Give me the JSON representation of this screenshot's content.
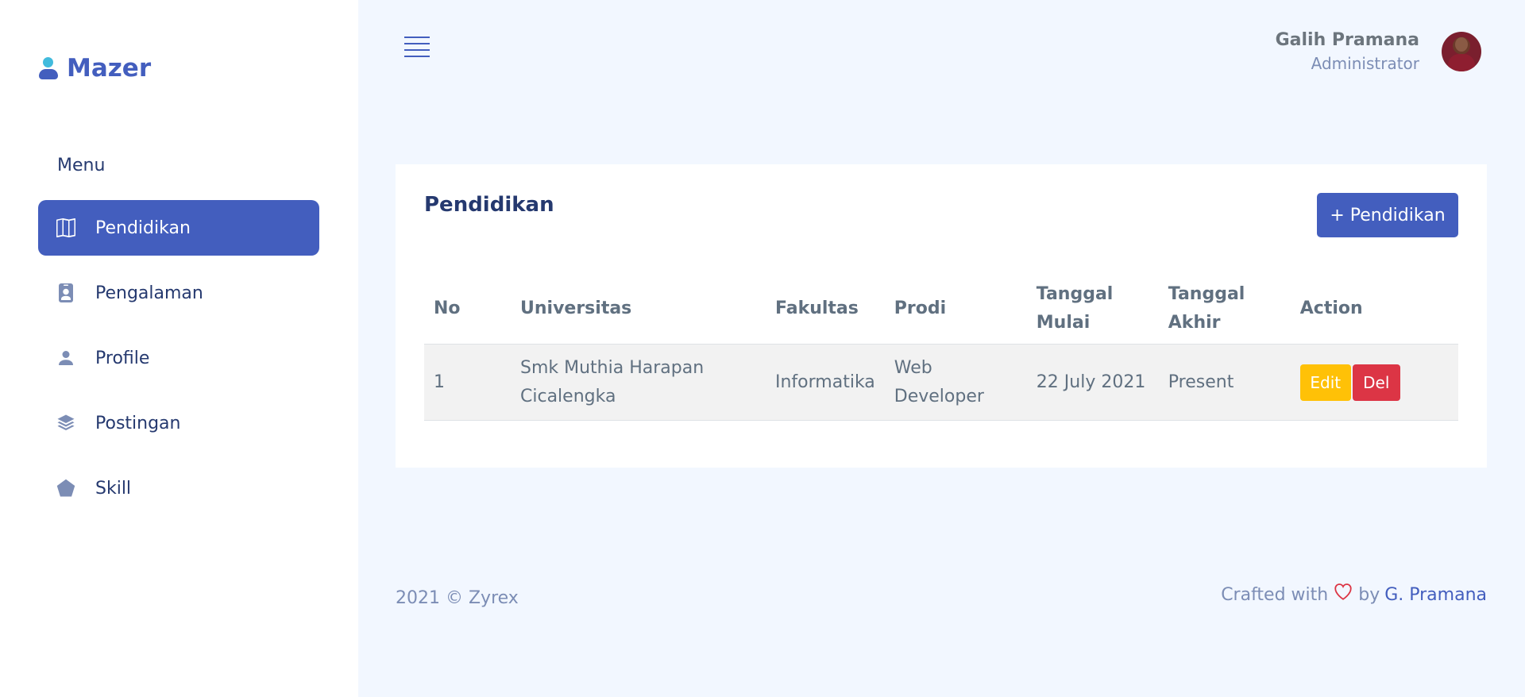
{
  "brand": {
    "name": "Mazer",
    "icon": "person-icon"
  },
  "sidebar": {
    "title": "Menu",
    "items": [
      {
        "label": "Pendidikan",
        "icon": "map-icon",
        "active": true
      },
      {
        "label": "Pengalaman",
        "icon": "person-badge-icon",
        "active": false
      },
      {
        "label": "Profile",
        "icon": "person-icon",
        "active": false
      },
      {
        "label": "Postingan",
        "icon": "stack-icon",
        "active": false
      },
      {
        "label": "Skill",
        "icon": "pentagon-icon",
        "active": false
      }
    ]
  },
  "header": {
    "user_name": "Galih Pramana",
    "user_role": "Administrator"
  },
  "card": {
    "title": "Pendidikan",
    "add_button": "+ Pendidikan"
  },
  "table": {
    "headers": [
      "No",
      "Universitas",
      "Fakultas",
      "Prodi",
      "Tanggal Mulai",
      "Tanggal Akhir",
      "Action"
    ],
    "rows": [
      {
        "no": "1",
        "universitas": "Smk Muthia Harapan Cicalengka",
        "fakultas": "Informatika",
        "prodi": "Web Developer",
        "tanggal_mulai": "22 July 2021",
        "tanggal_akhir": "Present",
        "edit_label": "Edit",
        "del_label": "Del"
      }
    ]
  },
  "footer": {
    "copyright": "2021 © Zyrex",
    "crafted_prefix": "Crafted with",
    "crafted_by": "by",
    "author": "G. Pramana"
  },
  "colors": {
    "primary": "#435ebe",
    "background": "#f2f7ff",
    "warning": "#ffc107",
    "danger": "#dc3545"
  }
}
